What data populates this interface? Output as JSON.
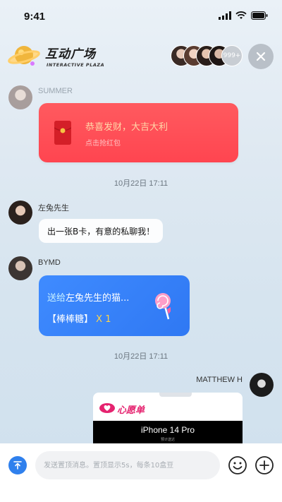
{
  "status_bar": {
    "time": "9:41"
  },
  "header": {
    "title": "互动广场",
    "subtitle": "INTERACTIVE PLAZA",
    "online_count": "999+",
    "icons": {
      "logo": "planet-logo-icon",
      "close": "close-icon"
    }
  },
  "messages": [
    {
      "type": "red_packet",
      "sender": "SUMMER",
      "title": "恭喜发财，大吉大利",
      "subtitle": "点击抢红包"
    },
    {
      "type": "timestamp",
      "text": "10月22日 17:11"
    },
    {
      "type": "text",
      "sender": "左兔先生",
      "text": "出一张B卡，有意的私聊我！"
    },
    {
      "type": "gift",
      "sender": "BYMD",
      "send_prefix": "送给",
      "recipient": "左兔先生的猫...",
      "gift_name": "【棒棒糖】",
      "quantity": "X 1",
      "icon": "lollipop-icon"
    },
    {
      "type": "timestamp",
      "text": "10月22日 17:11"
    },
    {
      "type": "wishlist",
      "sender": "MATTHEW H",
      "title": "心愿单",
      "product": "iPhone 14 Pro",
      "note": "预计送达"
    }
  ],
  "composer": {
    "placeholder": "发送置顶消息。置顶显示5s，每条10盒豆",
    "icons": {
      "pin": "pin-top-icon",
      "emoji": "emoji-icon",
      "plus": "plus-icon"
    }
  },
  "colors": {
    "red_packet": "#ff4d55",
    "gift_card": "#3a86fb",
    "gift_quantity": "#ffd44a",
    "wishlist_accent": "#e5236f",
    "pin_button": "#2f80ed"
  }
}
